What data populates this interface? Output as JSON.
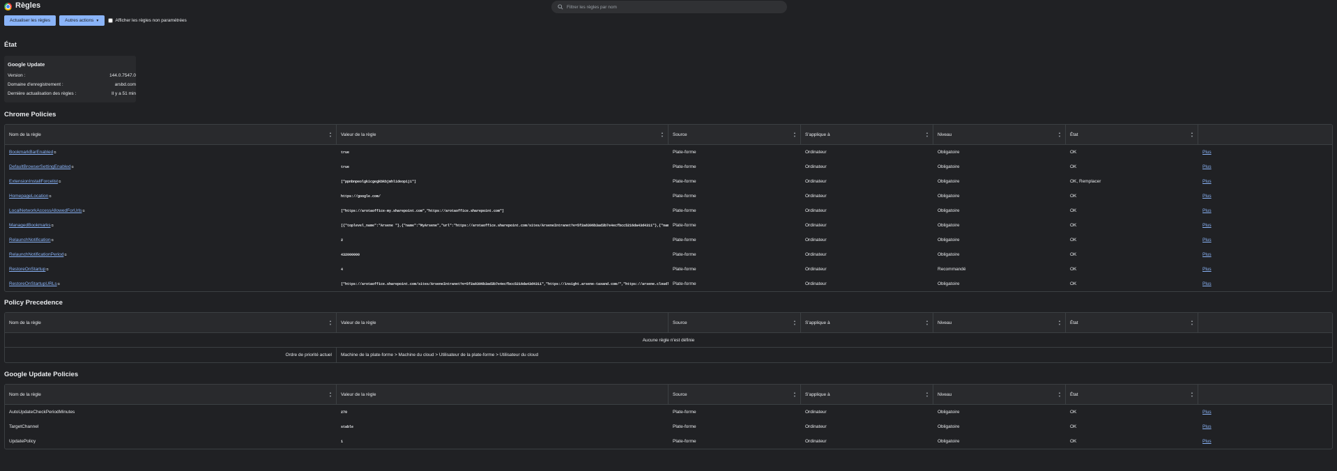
{
  "app": {
    "title": "Règles"
  },
  "search": {
    "placeholder": "Filtrer les règles par nom"
  },
  "toolbar": {
    "reload_label": "Actualiser les règles",
    "more_actions_label": "Autres actions",
    "show_unset_label": "Afficher les règles non paramétrées"
  },
  "status": {
    "section_title": "État",
    "card_title": "Google Update",
    "rows": [
      {
        "label": "Version :",
        "value": "144.0.7547.0"
      },
      {
        "label": "Domaine d'enregistrement :",
        "value": "arsbd.com"
      },
      {
        "label": "Dernière actualisation des règles :",
        "value": "Il y a 51 min"
      }
    ]
  },
  "headers": [
    "Nom de la règle",
    "Valeur de la règle",
    "Source",
    "S'applique à",
    "Niveau",
    "État",
    ""
  ],
  "chrome_policies": {
    "title": "Chrome Policies",
    "rows": [
      {
        "name": "BookmarkBarEnabled",
        "value": "true",
        "source": "Plate-forme",
        "applies": "Ordinateur",
        "level": "Obligatoire",
        "status": "OK",
        "more": "Plus"
      },
      {
        "name": "DefaultBrowserSettingEnabled",
        "value": "true",
        "source": "Plate-forme",
        "applies": "Ordinateur",
        "level": "Obligatoire",
        "status": "OK",
        "more": "Plus"
      },
      {
        "name": "ExtensionInstallForcelist",
        "value": "[\"ppnbnpeolgkicgegkbkbjmhlideopiji\"]",
        "source": "Plate-forme",
        "applies": "Ordinateur",
        "level": "Obligatoire",
        "status": "OK, Remplacer",
        "more": "Plus"
      },
      {
        "name": "HomepageLocation",
        "value": "https://google.com/",
        "source": "Plate-forme",
        "applies": "Ordinateur",
        "level": "Obligatoire",
        "status": "OK",
        "more": "Plus"
      },
      {
        "name": "LocalNetworkAccessAllowedForUrls",
        "value": "[\"https://arotaoffice-my.sharepoint.com\",\"https://arotaoffice.sharepoint.com\"]",
        "source": "Plate-forme",
        "applies": "Ordinateur",
        "level": "Obligatoire",
        "status": "OK",
        "more": "Plus"
      },
      {
        "name": "ManagedBookmarks",
        "value": "[{\"toplevel_name\":\"Arsene \"},{\"name\":\"MyArsene\",\"url\":\"https://arotaoffice.sharepoint.com/sites/ArseneIntranet?e=5f2a8306b3ad3b7e4ecfbcc5216da43d4311\"},{\"nam…",
        "source": "Plate-forme",
        "applies": "Ordinateur",
        "level": "Obligatoire",
        "status": "OK",
        "more": "Plus"
      },
      {
        "name": "RelaunchNotification",
        "value": "2",
        "source": "Plate-forme",
        "applies": "Ordinateur",
        "level": "Obligatoire",
        "status": "OK",
        "more": "Plus"
      },
      {
        "name": "RelaunchNotificationPeriod",
        "value": "432000000",
        "source": "Plate-forme",
        "applies": "Ordinateur",
        "level": "Obligatoire",
        "status": "OK",
        "more": "Plus"
      },
      {
        "name": "RestoreOnStartup",
        "value": "4",
        "source": "Plate-forme",
        "applies": "Ordinateur",
        "level": "Recommandé",
        "status": "OK",
        "more": "Plus"
      },
      {
        "name": "RestoreOnStartupURLs",
        "value": "[\"https://arotaoffice.sharepoint.com/sites/ArseneIntranet?e=5f2a8306b3ad3b7e4ecfbcc5216da43d4311\",\"https://insight.arsene-taxand.com/\",\"https://arsene.cloudl…",
        "source": "Plate-forme",
        "applies": "Ordinateur",
        "level": "Obligatoire",
        "status": "OK",
        "more": "Plus"
      }
    ]
  },
  "precedence": {
    "title": "Policy Precedence",
    "none_text": "Aucune règle n'est définie",
    "order_label": "Ordre de priorité actuel",
    "order_value": "Machine de la plate-forme > Machine du cloud > Utilisateur de la plate-forme > Utilisateur du cloud"
  },
  "google_update_policies": {
    "title": "Google Update Policies",
    "rows": [
      {
        "name": "AutoUpdateCheckPeriodMinutes",
        "value": "270",
        "source": "Plate-forme",
        "applies": "Ordinateur",
        "level": "Obligatoire",
        "status": "OK",
        "more": "Plus"
      },
      {
        "name": "TargetChannel",
        "value": "stable",
        "source": "Plate-forme",
        "applies": "Ordinateur",
        "level": "Obligatoire",
        "status": "OK",
        "more": "Plus"
      },
      {
        "name": "UpdatePolicy",
        "value": "1",
        "source": "Plate-forme",
        "applies": "Ordinateur",
        "level": "Obligatoire",
        "status": "OK",
        "more": "Plus"
      }
    ]
  }
}
